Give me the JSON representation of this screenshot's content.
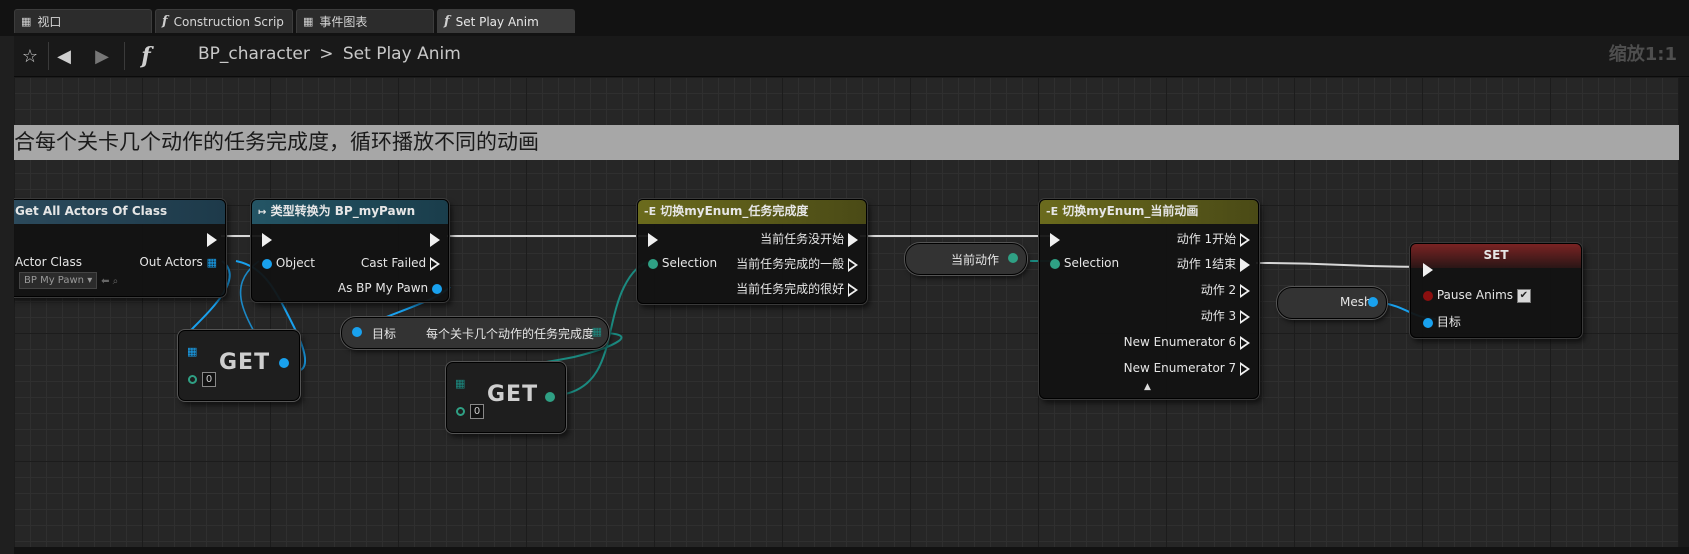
{
  "tabs": [
    {
      "label": "视口",
      "icon": "viewport-icon",
      "active": false
    },
    {
      "label": "Construction Scrip",
      "icon": "function-icon",
      "active": false
    },
    {
      "label": "事件图表",
      "icon": "event-graph-icon",
      "active": false
    },
    {
      "label": "Set Play Anim",
      "icon": "function-icon",
      "active": true
    }
  ],
  "breadcrumb": {
    "root": "BP_character",
    "separator": ">",
    "current": "Set Play Anim"
  },
  "zoom": "缩放1:1",
  "comment": "合每个关卡几个动作的任务完成度，循环播放不同的动画",
  "nodes": {
    "get_all_actors": {
      "title": "Get All Actors Of Class",
      "actor_class": "Actor Class",
      "actor_class_value": "BP My Pawn",
      "out_actors": "Out Actors"
    },
    "cast": {
      "title": "类型转换为 BP_myPawn",
      "object": "Object",
      "cast_failed": "Cast Failed",
      "as_pawn": "As BP My Pawn"
    },
    "get1": {
      "label": "GET",
      "index": "0"
    },
    "get2": {
      "label": "GET",
      "index": "0"
    },
    "target_var": {
      "target": "目标",
      "var": "每个关卡几个动作的任务完成度"
    },
    "switch1": {
      "title": "切换myEnum_任务完成度",
      "selection": "Selection",
      "outputs": [
        "当前任务没开始",
        "当前任务完成的一般",
        "当前任务完成的很好"
      ]
    },
    "cur_action": {
      "label": "当前动作"
    },
    "switch2": {
      "title": "切换myEnum_当前动画",
      "selection": "Selection",
      "outputs": [
        "动作 1开始",
        "动作 1结束",
        "动作 2",
        "动作 3",
        "New Enumerator 6",
        "New Enumerator 7"
      ]
    },
    "mesh": {
      "label": "Mesh"
    },
    "set": {
      "title": "SET",
      "pause_anims": "Pause Anims",
      "target": "目标",
      "pause_checked": true
    }
  }
}
